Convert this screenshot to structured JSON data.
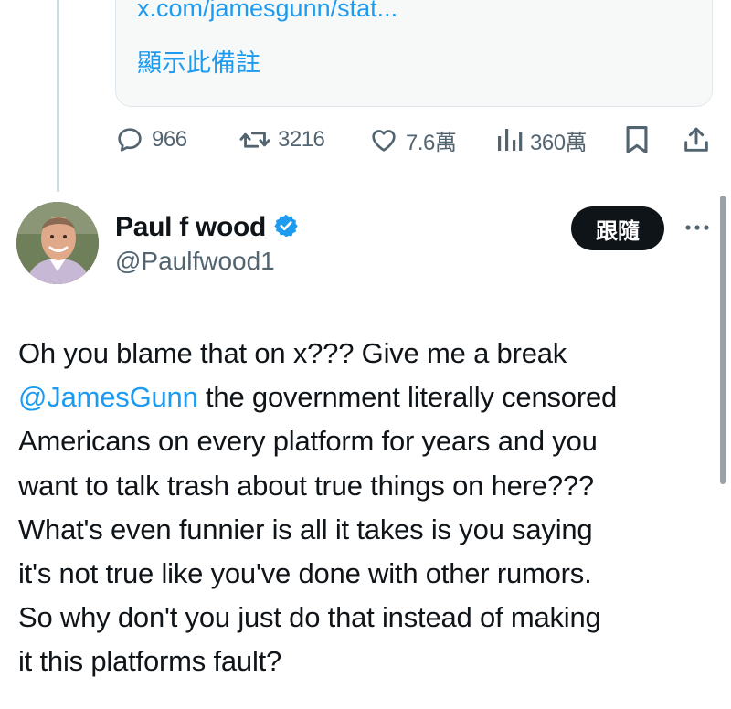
{
  "quoted_card": {
    "link_text": "x.com/jamesgunn/stat...",
    "show_note_label": "顯示此備註"
  },
  "actions": {
    "reply_count": "966",
    "retweet_count": "3216",
    "like_count": "7.6萬",
    "view_count": "360萬"
  },
  "author": {
    "name": "Paul f wood",
    "handle": "@Paulfwood1",
    "verified": true,
    "follow_label": "跟隨"
  },
  "tweet": {
    "line1": "Oh you blame that on x??? Give me a break",
    "mention": "@JamesGunn",
    "line2_rest": " the government literally censored",
    "line3": "Americans on every platform for years and you",
    "line4": "want to talk trash about true things on here???",
    "line5": "What's even funnier is all it takes is you saying",
    "line6": "it's not true like you've done with other rumors.",
    "line7": "So why don't you just do that instead of making",
    "line8": "it this platforms fault?"
  },
  "colors": {
    "accent": "#1d9bf0",
    "text_primary": "#0f1419",
    "text_secondary": "#536471",
    "follow_button_bg": "#0f1419"
  },
  "icons": {
    "reply": "speech-bubble-icon",
    "retweet": "retweet-arrows-icon",
    "like": "heart-icon",
    "views": "bar-chart-icon",
    "bookmark": "bookmark-icon",
    "share": "share-upload-icon",
    "verified": "verified-badge-icon",
    "more": "more-dots-icon"
  }
}
